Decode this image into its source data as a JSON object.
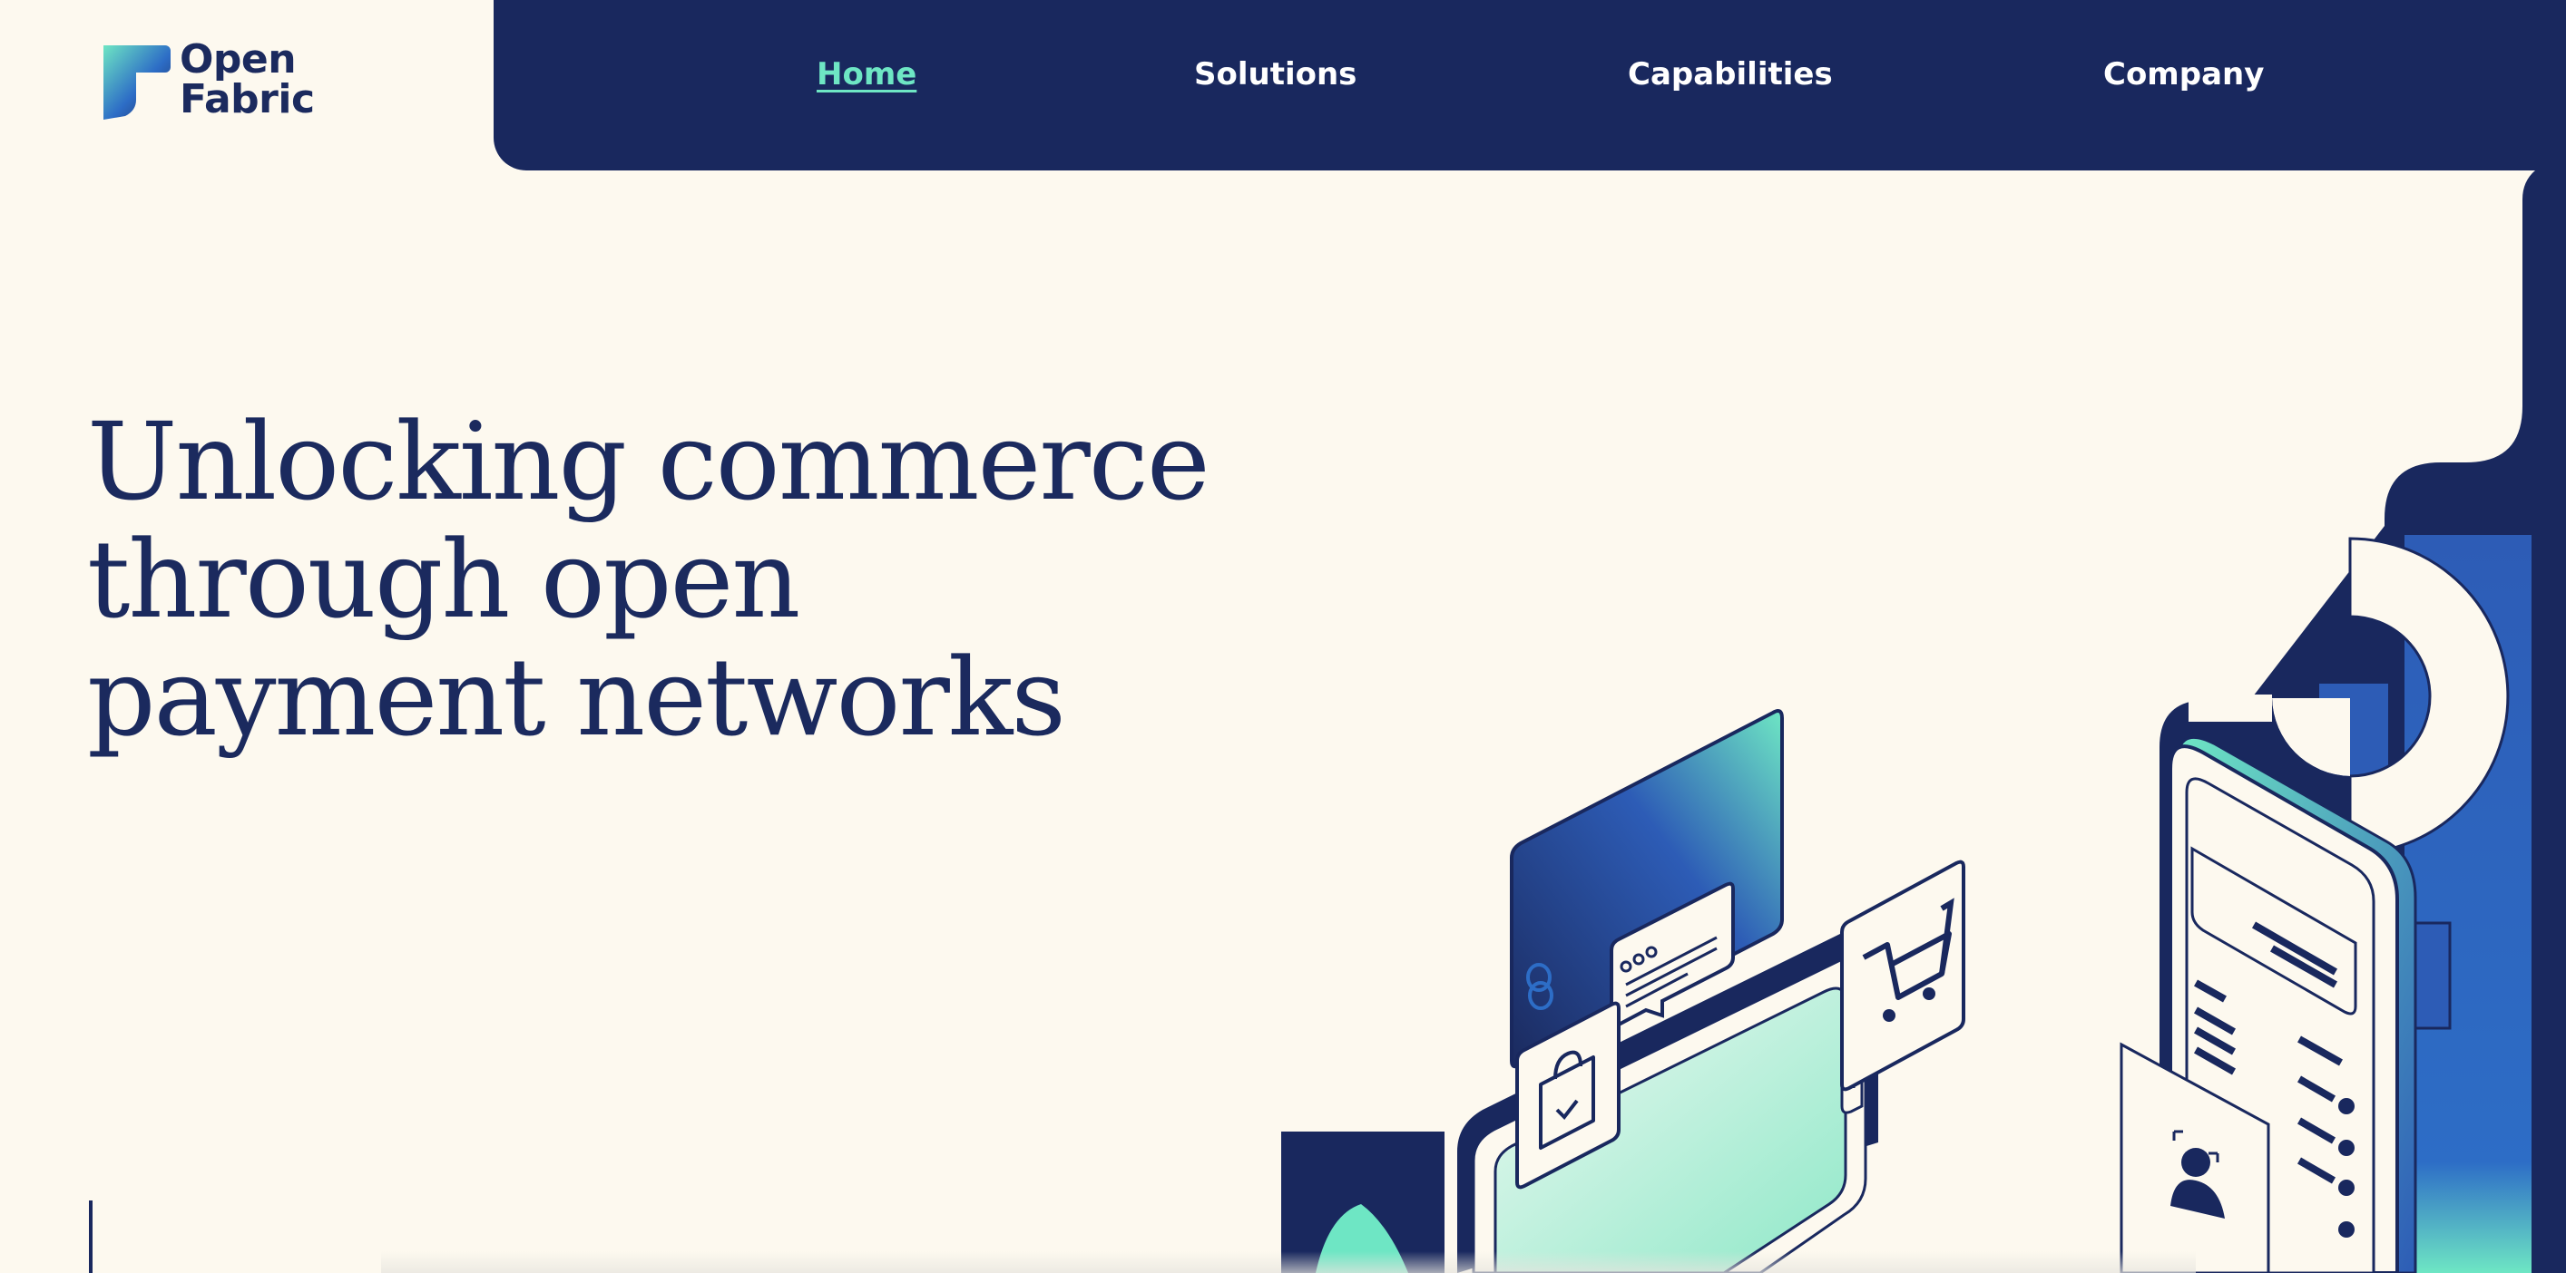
{
  "brand": {
    "name_line1": "Open",
    "name_line2": "Fabric",
    "primary_color": "#19285e",
    "accent_color": "#6ee6c4",
    "background_color": "#fdf9ef"
  },
  "nav": {
    "items": [
      {
        "label": "Home",
        "active": true
      },
      {
        "label": "Solutions",
        "active": false
      },
      {
        "label": "Capabilities",
        "active": false
      },
      {
        "label": "Company",
        "active": false
      }
    ]
  },
  "hero": {
    "title_lines": [
      "Unlocking commerce",
      "through open",
      "payment networks"
    ]
  },
  "illustration": {
    "icons": [
      "link-icon",
      "chat-icon",
      "shopping-cart-icon",
      "shopping-bag-icon",
      "user-profile-icon"
    ]
  }
}
